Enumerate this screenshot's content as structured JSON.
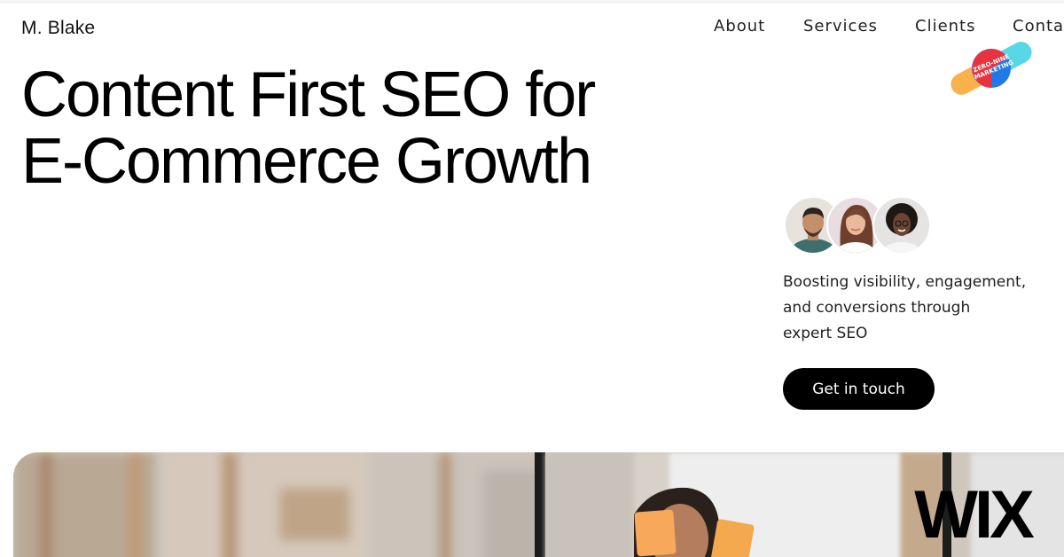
{
  "header": {
    "brand": "M. Blake",
    "nav": [
      "About",
      "Services",
      "Clients",
      "Conta"
    ]
  },
  "logo": {
    "text_line1": "ZERO-NINE",
    "text_line2": "MARKETING",
    "colors": {
      "orange": "#f9b24b",
      "cyan": "#58d7e6",
      "red": "#e8323e",
      "blue": "#1f79e7"
    }
  },
  "hero": {
    "title_line1": "Content First SEO for",
    "title_line2": "E-Commerce Growth"
  },
  "team": {
    "avatars": [
      {
        "name": "avatar-man",
        "bg": "#e7e2dc",
        "shirt": "#3e6f6d"
      },
      {
        "name": "avatar-woman-long-hair",
        "bg": "#e8dde0",
        "shirt": "#ffffff"
      },
      {
        "name": "avatar-woman-curly-hair",
        "bg": "#e6e4e2",
        "shirt": "#f6f6f6"
      }
    ]
  },
  "tagline": {
    "line1": "Boosting visibility, engagement,",
    "line2": "and conversions through",
    "line3": "expert SEO"
  },
  "cta": {
    "label": "Get in touch"
  },
  "watermark": {
    "text": "WIX"
  },
  "colors": {
    "background": "#ffffff",
    "text": "#000000",
    "button_bg": "#000000",
    "button_text": "#ffffff",
    "sticky_note": "#f7a85a"
  }
}
